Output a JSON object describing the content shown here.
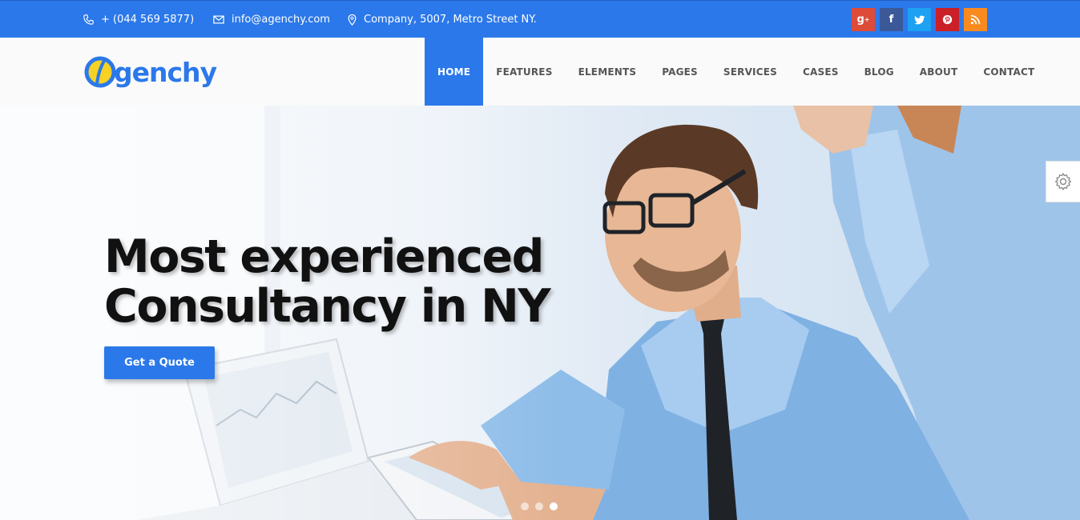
{
  "topbar": {
    "phone": "+ (044 569 5877)",
    "email": "info@agenchy.com",
    "address": "Company, 5007, Metro Street NY.",
    "social": [
      {
        "name": "google-plus",
        "glyph": "g+",
        "color": "#dd4b39"
      },
      {
        "name": "facebook",
        "glyph": "f",
        "color": "#3b5998"
      },
      {
        "name": "twitter",
        "glyph": "t",
        "color": "#1da1f2"
      },
      {
        "name": "pinterest",
        "glyph": "p",
        "color": "#cb2027"
      },
      {
        "name": "rss",
        "glyph": "rss",
        "color": "#f98a1e"
      }
    ]
  },
  "header": {
    "logo_text": "gench",
    "nav": [
      "HOME",
      "FEATURES",
      "ELEMENTS",
      "PAGES",
      "SERVICES",
      "CASES",
      "BLOG",
      "ABOUT",
      "CONTACT"
    ],
    "active_nav": "HOME"
  },
  "hero": {
    "headline_line1": "Most experienced",
    "headline_line2": "Consultancy in NY",
    "cta_label": "Get a Quote",
    "slides": 3,
    "active_slide": 3
  },
  "colors": {
    "accent": "#2b78ea",
    "logo_yellow": "#f5d223"
  },
  "icons": {
    "phone": "phone-icon",
    "email": "envelope-icon",
    "address": "map-pin-icon",
    "settings": "gear-icon"
  }
}
